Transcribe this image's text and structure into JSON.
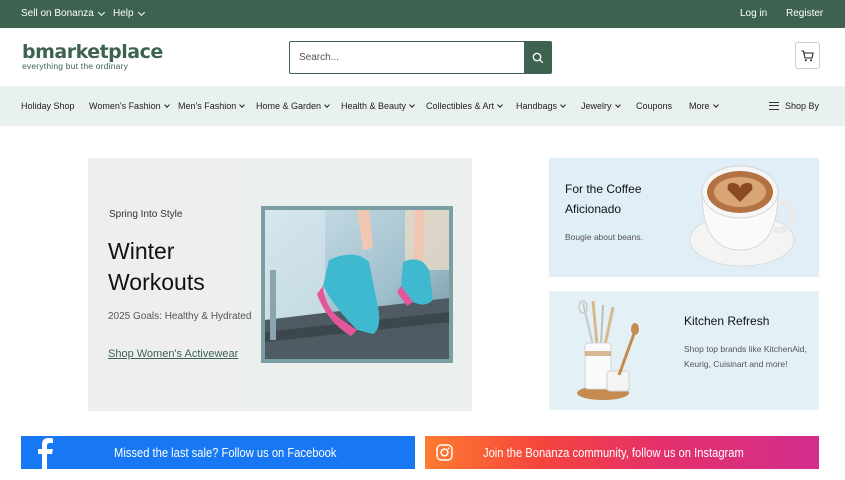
{
  "topbar": {
    "sell_label": "Sell on Bonanza",
    "help_label": "Help",
    "login_label": "Log in",
    "register_label": "Register"
  },
  "header": {
    "logo_text": "bmarketplace",
    "logo_tagline": "everything but the ordinary",
    "search_placeholder": "Search...",
    "search_icon": "search-icon",
    "cart_icon": "cart-icon"
  },
  "category_nav": {
    "items": [
      {
        "label": "Holiday Shop",
        "has_dropdown": false
      },
      {
        "label": "Women's Fashion",
        "has_dropdown": true
      },
      {
        "label": "Men's Fashion",
        "has_dropdown": true
      },
      {
        "label": "Home & Garden",
        "has_dropdown": true
      },
      {
        "label": "Health & Beauty",
        "has_dropdown": true
      },
      {
        "label": "Collectibles & Art",
        "has_dropdown": true
      },
      {
        "label": "Handbags",
        "has_dropdown": true
      },
      {
        "label": "Jewelry",
        "has_dropdown": true
      },
      {
        "label": "Coupons",
        "has_dropdown": false
      },
      {
        "label": "More",
        "has_dropdown": true
      }
    ],
    "shop_by_label": "Shop By"
  },
  "hero": {
    "kicker": "Spring Into Style",
    "title": "Winter Workouts",
    "subtitle": "2025 Goals: Healthy & Hydrated",
    "link_label": "Shop Women's Activewear"
  },
  "promos": [
    {
      "title": "For the Coffee Aficionado",
      "subtitle": "Bougie about beans."
    },
    {
      "title": "Kitchen Refresh",
      "subtitle": "Shop top brands like KitchenAid, Keurig, Cuisinart and more!"
    }
  ],
  "social": {
    "facebook_text": "Missed the last sale? Follow us on Facebook",
    "instagram_text": "Join the Bonanza community, follow us on Instagram"
  },
  "colors": {
    "brand_green": "#3d6350",
    "nav_bg": "#e9f1ee",
    "facebook_blue": "#1877f2",
    "promo_bg": "#dfeef7"
  }
}
